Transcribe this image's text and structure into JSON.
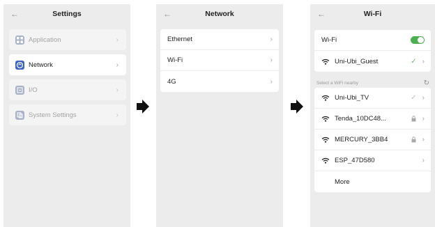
{
  "settings": {
    "title": "Settings",
    "back_icon": "arrow-left-icon",
    "items": [
      {
        "label": "Application",
        "icon": "apps-icon"
      },
      {
        "label": "Network",
        "icon": "network-icon"
      },
      {
        "label": "I/O",
        "icon": "io-icon"
      },
      {
        "label": "System Settings",
        "icon": "system-settings-icon"
      }
    ]
  },
  "network": {
    "title": "Network",
    "items": [
      {
        "label": "Ethernet"
      },
      {
        "label": "Wi-Fi"
      },
      {
        "label": "4G"
      }
    ]
  },
  "wifi": {
    "title": "Wi-Fi",
    "toggle_label": "Wi-Fi",
    "toggle_on": true,
    "connected": {
      "ssid": "Uni-Ubi_Guest"
    },
    "section_label": "Select a WiFi nearby",
    "networks": [
      {
        "ssid": "Uni-Ubi_TV",
        "status": "check"
      },
      {
        "ssid": "Tenda_10DC48...",
        "status": "lock"
      },
      {
        "ssid": "MERCURY_3BB4",
        "status": "lock"
      },
      {
        "ssid": "ESP_47D580",
        "status": "none"
      }
    ],
    "more_label": "More"
  },
  "colors": {
    "accent_blue": "#3a62c4",
    "toggle_green": "#4caf50",
    "check_green": "#69b86a"
  }
}
